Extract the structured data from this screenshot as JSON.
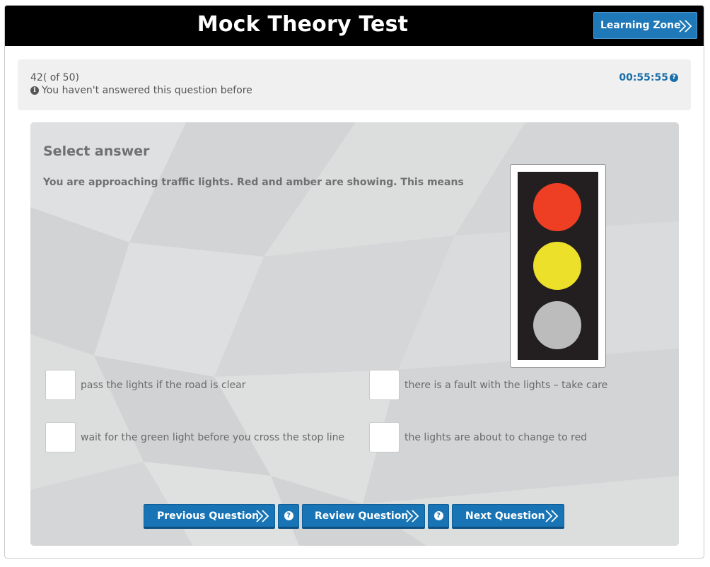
{
  "header": {
    "title": "Mock Theory Test",
    "learning_zone_label": "Learning Zone"
  },
  "status": {
    "counter": "42( of 50)",
    "answered_note": "You haven't answered this question before",
    "timer": "00:55:55"
  },
  "question": {
    "heading": "Select answer",
    "text": "You are approaching traffic lights. Red and amber are showing. This means",
    "image_lights": {
      "red": "#ee3e24",
      "amber": "#ece02a",
      "green_off": "#bcbcbc"
    },
    "options": [
      {
        "label": "pass the lights if the road is clear"
      },
      {
        "label": "there is a fault with the lights – take care"
      },
      {
        "label": "wait for the green light before you cross the stop line"
      },
      {
        "label": "the lights are about to change to red"
      }
    ]
  },
  "footer": {
    "previous_label": "Previous Question",
    "review_label": "Review Question",
    "next_label": "Next Question",
    "help_glyph": "?"
  },
  "colors": {
    "accent": "#1874b5",
    "header_bg": "#000000",
    "timer": "#1b6fa8"
  }
}
